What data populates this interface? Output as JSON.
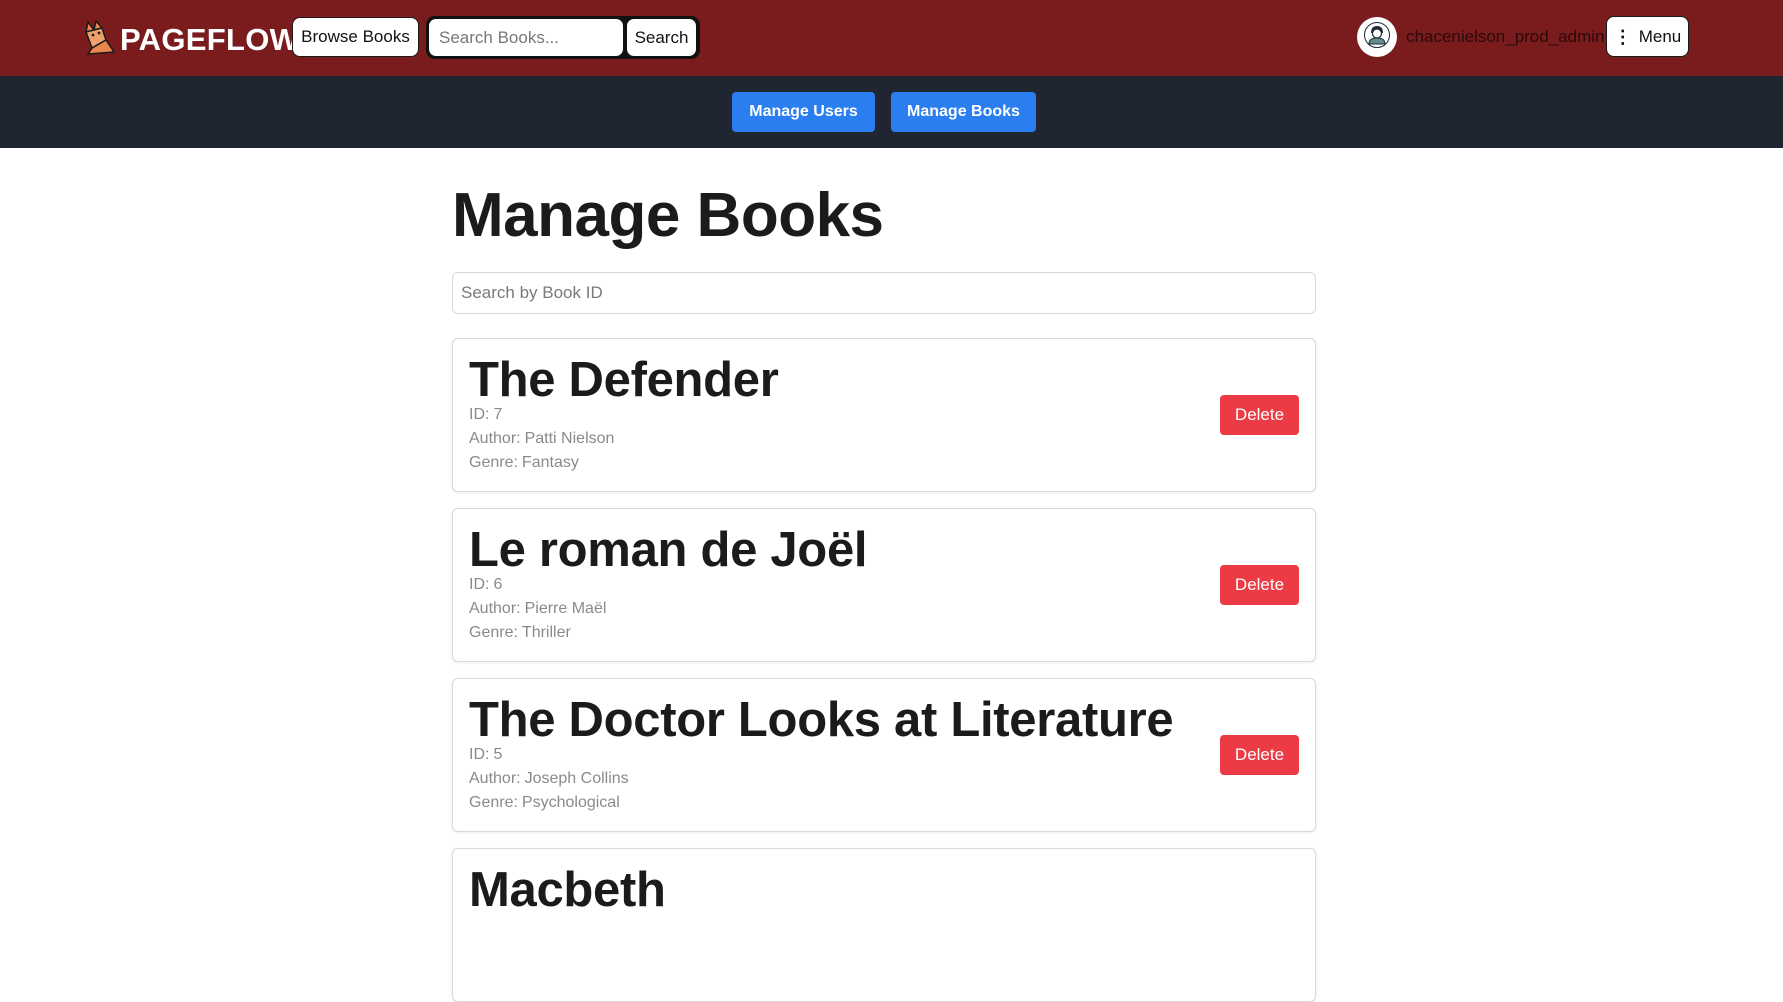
{
  "header": {
    "brand": "PAGEFLOW",
    "browse_label": "Browse Books",
    "search_placeholder": "Search Books...",
    "search_label": "Search",
    "username": "chacenielson_prod_admin",
    "menu_label": "Menu",
    "menu_icon": "⋮"
  },
  "admin_nav": {
    "users_label": "Manage Users",
    "books_label": "Manage Books"
  },
  "main": {
    "title": "Manage Books",
    "search_placeholder": "Search by Book ID",
    "id_prefix": "ID:",
    "author_prefix": "Author:",
    "genre_prefix": "Genre:",
    "delete_label": "Delete",
    "books": [
      {
        "title": "The Defender",
        "id": "7",
        "author": "Patti Nielson",
        "genre": "Fantasy"
      },
      {
        "title": "Le roman de Joël",
        "id": "6",
        "author": "Pierre Maël",
        "genre": "Thriller"
      },
      {
        "title": "The Doctor Looks at Literature",
        "id": "5",
        "author": "Joseph Collins",
        "genre": "Psychological"
      },
      {
        "title": "Macbeth",
        "id": "",
        "author": "",
        "genre": ""
      }
    ]
  },
  "colors": {
    "topbar": "#7a1c1e",
    "adminbar": "#1f2631",
    "primary": "#2a7ef0",
    "danger": "#ed3b45"
  },
  "icons": {
    "logo": "fox-book-logo-icon",
    "avatar": "user-avatar-icon",
    "menu": "vertical-dots-icon"
  }
}
